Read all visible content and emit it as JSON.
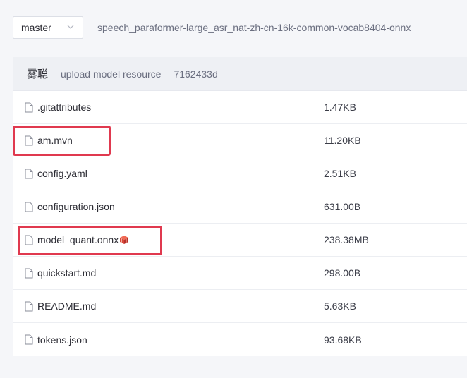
{
  "toolbar": {
    "branch": "master",
    "repo_path": "speech_paraformer-large_asr_nat-zh-cn-16k-common-vocab8404-onnx"
  },
  "commit": {
    "author": "雾聪",
    "message": "upload model resource",
    "hash": "7162433d"
  },
  "files": [
    {
      "name": ".gitattributes",
      "size": "1.47KB"
    },
    {
      "name": "am.mvn",
      "size": "11.20KB"
    },
    {
      "name": "config.yaml",
      "size": "2.51KB"
    },
    {
      "name": "configuration.json",
      "size": "631.00B"
    },
    {
      "name": "model_quant.onnx",
      "size": "238.38MB"
    },
    {
      "name": "quickstart.md",
      "size": "298.00B"
    },
    {
      "name": "README.md",
      "size": "5.63KB"
    },
    {
      "name": "tokens.json",
      "size": "93.68KB"
    }
  ],
  "colors": {
    "highlight": "#e0394f",
    "cube_icon": "#d9473a"
  },
  "icons": {
    "branch_dropdown": "chevron-down-icon",
    "file": "file-icon",
    "lfs_badge": "cube-icon"
  }
}
